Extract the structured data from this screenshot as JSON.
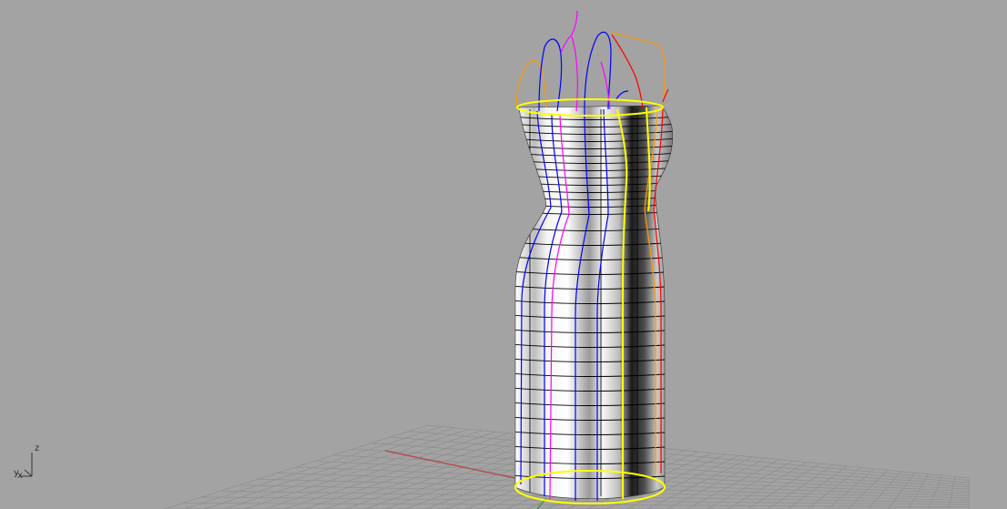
{
  "viewport": {
    "background": "#a3a3a3",
    "grid_color": "#8e8e8e",
    "x_axis_color": "#b05050",
    "y_axis_color": "#3a9a50"
  },
  "axis_widget": {
    "z_label": "z",
    "y_label": "y",
    "x_label": "x"
  },
  "curve_colors": {
    "selected": "#ffff00",
    "isocurve": "#000000",
    "blue": "#0000ff",
    "magenta": "#ff00ff",
    "red": "#ff0000",
    "orange": "#ff9900"
  }
}
